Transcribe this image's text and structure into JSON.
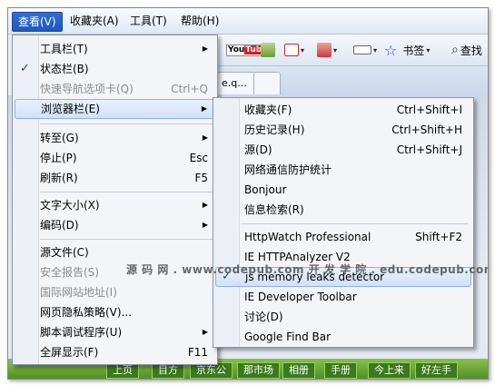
{
  "menubar": {
    "items": [
      {
        "label": "查看(V)"
      },
      {
        "label": "收藏夹(A)"
      },
      {
        "label": "工具(T)"
      },
      {
        "label": "帮助(H)"
      }
    ]
  },
  "toolbar": {
    "youtube_label": "You Tube",
    "bookmarks_label": "书签",
    "search_label": "查找",
    "tab_label": "e.q..."
  },
  "view_menu": {
    "items": [
      {
        "label": "工具栏(T)",
        "shortcut": ""
      },
      {
        "label": "状态栏(B)",
        "shortcut": ""
      },
      {
        "label": "快速导航选项卡(Q)",
        "shortcut": "Ctrl+Q"
      },
      {
        "label": "浏览器栏(E)",
        "shortcut": ""
      },
      {
        "label": "转至(G)",
        "shortcut": ""
      },
      {
        "label": "停止(P)",
        "shortcut": "Esc"
      },
      {
        "label": "刷新(R)",
        "shortcut": "F5"
      },
      {
        "label": "文字大小(X)",
        "shortcut": ""
      },
      {
        "label": "编码(D)",
        "shortcut": ""
      },
      {
        "label": "源文件(C)",
        "shortcut": ""
      },
      {
        "label": "安全报告(S)",
        "shortcut": ""
      },
      {
        "label": "国际网站地址(I)",
        "shortcut": ""
      },
      {
        "label": "网页隐私策略(V)...",
        "shortcut": ""
      },
      {
        "label": "脚本调试程序(U)",
        "shortcut": ""
      },
      {
        "label": "全屏显示(F)",
        "shortcut": "F11"
      }
    ]
  },
  "explorer_bar_menu": {
    "items": [
      {
        "label": "收藏夹(F)",
        "shortcut": "Ctrl+Shift+I"
      },
      {
        "label": "历史记录(H)",
        "shortcut": "Ctrl+Shift+H"
      },
      {
        "label": "源(D)",
        "shortcut": "Ctrl+Shift+J"
      },
      {
        "label": "网络通信防护统计",
        "shortcut": ""
      },
      {
        "label": "Bonjour",
        "shortcut": ""
      },
      {
        "label": "信息检索(R)",
        "shortcut": ""
      },
      {
        "label": "HttpWatch Professional",
        "shortcut": "Shift+F2"
      },
      {
        "label": "IE HTTPAnalyzer V2",
        "shortcut": ""
      },
      {
        "label": "js memory leaks detector",
        "shortcut": ""
      },
      {
        "label": "IE Developer Toolbar",
        "shortcut": ""
      },
      {
        "label": "讨论(D)",
        "shortcut": ""
      },
      {
        "label": "Google Find Bar",
        "shortcut": ""
      }
    ]
  },
  "watermark": "源 码 网 . www.codepub.com   开 发 学 院 . edu.codepub.com",
  "bottom_nav": [
    "上页",
    "目方",
    "京东公",
    "那市场",
    "相册",
    "手册",
    "今上来",
    "好左手"
  ]
}
